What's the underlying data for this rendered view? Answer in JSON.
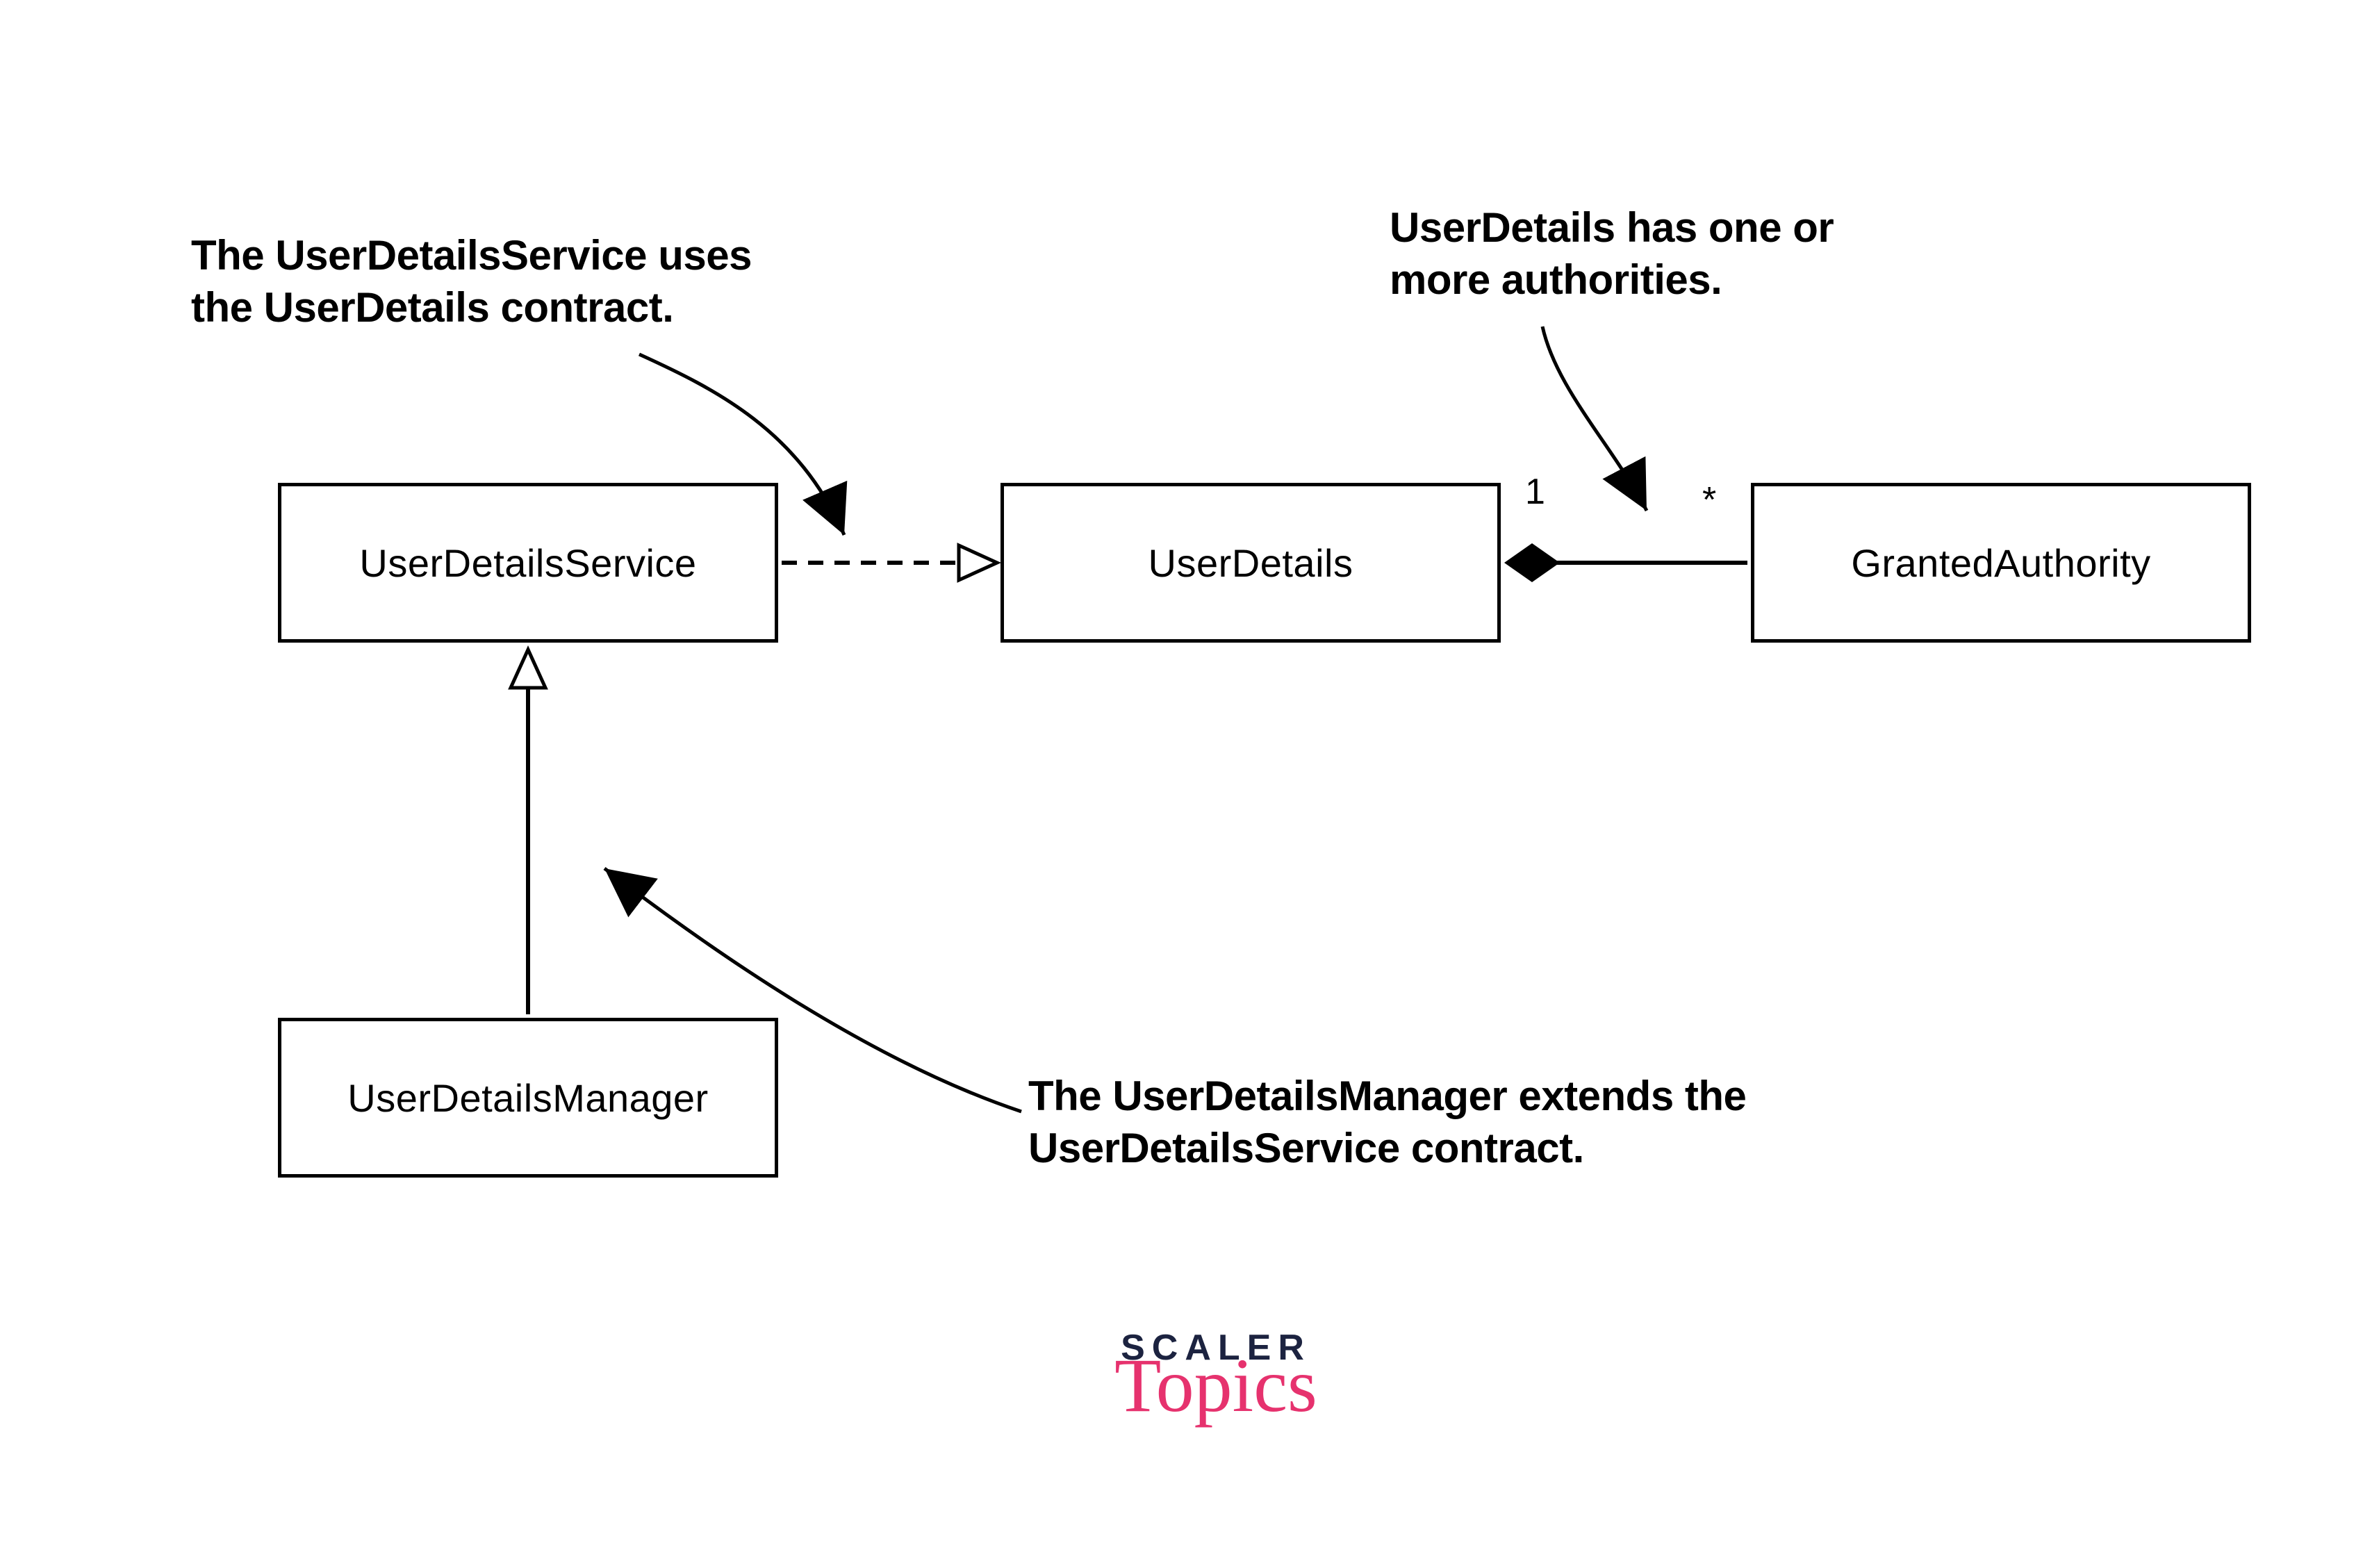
{
  "annotations": {
    "top_left": "The UserDetailsService uses the UserDetails contract.",
    "top_right": "UserDetails has one or more authorities.",
    "bottom": "The UserDetailsManager extends the UserDetailsService contract."
  },
  "boxes": {
    "user_details_service": "UserDetailsService",
    "user_details": "UserDetails",
    "granted_authority": "GrantedAuthority",
    "user_details_manager": "UserDetailsManager"
  },
  "multiplicity": {
    "one": "1",
    "many": "*"
  },
  "logo": {
    "line1": "SCALER",
    "line2": "Topics"
  }
}
